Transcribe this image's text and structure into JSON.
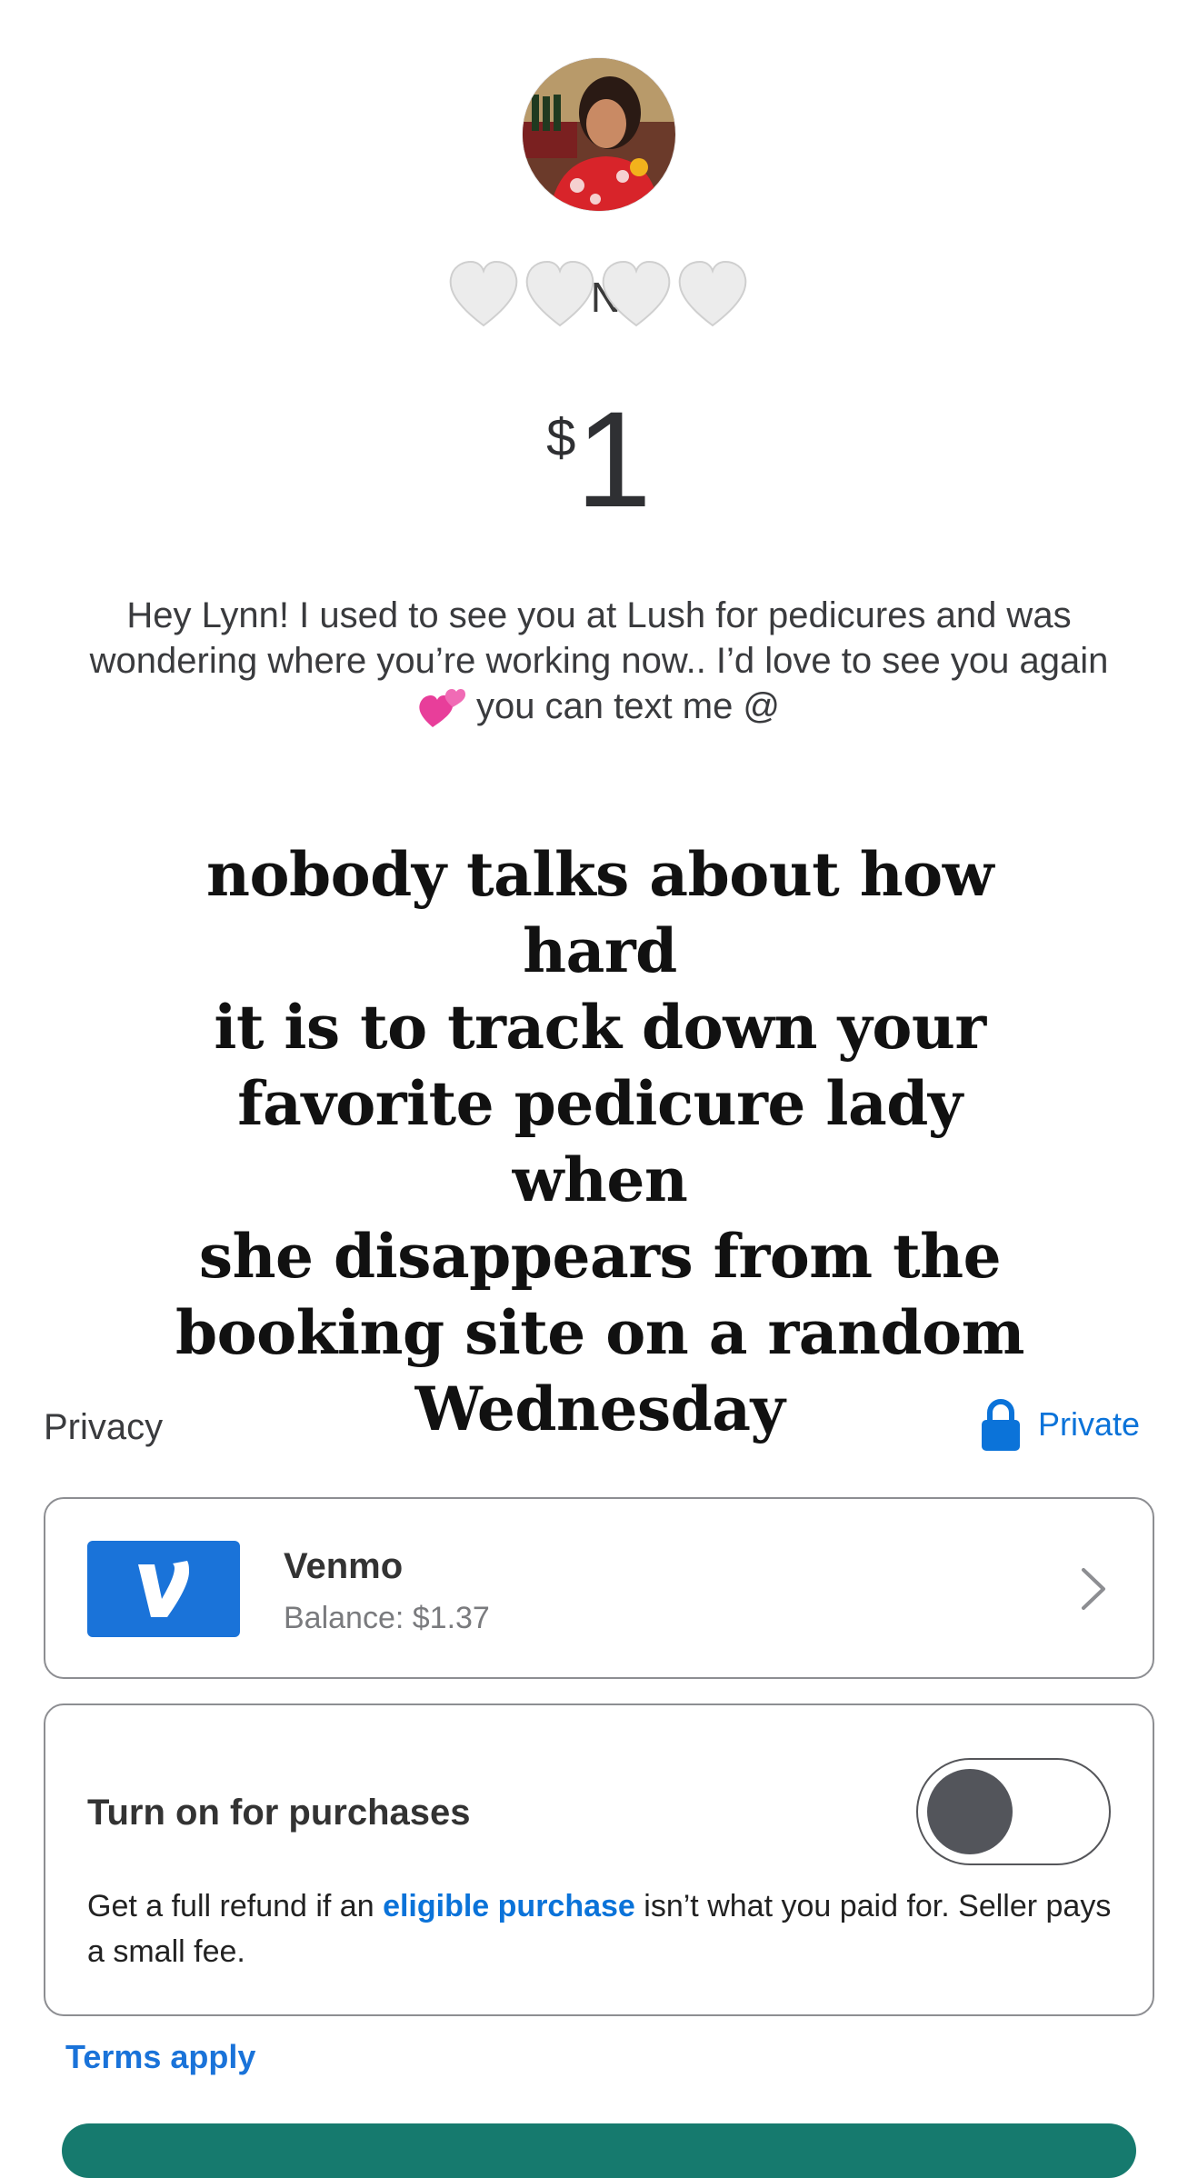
{
  "recipient": {
    "name_partial": "n  Ng",
    "name_cover_emoji": "white-hearts"
  },
  "amount": {
    "currency": "$",
    "value": "1"
  },
  "note": {
    "line1": "Hey Lynn! I used to see you at Lush for pedicures and was",
    "line2": "wondering where you’re working now.. I’d love to see you again",
    "line3": "you can text me @",
    "emoji": "two-hearts"
  },
  "caption": {
    "lines": [
      "nobody talks about how hard",
      "it is to track down your",
      "favorite pedicure lady when",
      "she disappears from the",
      "booking site on a random",
      "Wednesday"
    ]
  },
  "privacy": {
    "label": "Privacy",
    "value": "Private",
    "icon": "lock-icon"
  },
  "payment": {
    "method": "Venmo",
    "balance": "Balance: $1.37",
    "logo_letter": "V"
  },
  "protection": {
    "title": "Turn on for purchases",
    "toggle_on": false,
    "desc_before": "Get a full refund if an ",
    "desc_link": "eligible purchase",
    "desc_after": " isn’t what you paid for. Seller pays a small fee."
  },
  "terms": {
    "label": "Terms apply"
  },
  "colors": {
    "accent_blue": "#0b73d9",
    "venmo_blue": "#1a73d9",
    "bottom_button": "#167a6e"
  }
}
